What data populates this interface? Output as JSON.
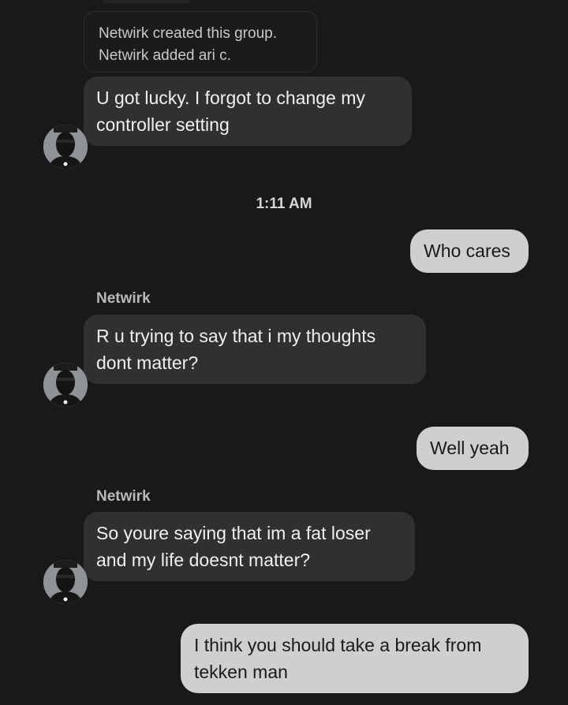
{
  "system": {
    "line1": "Netwirk created this group.",
    "line2": "Netwirk added ari c."
  },
  "timestamp": "1:11 AM",
  "messages": [
    {
      "direction": "incoming",
      "lines": [
        "U got lucky. I forgot to change my",
        "controller setting"
      ]
    },
    {
      "direction": "outgoing",
      "lines": [
        "Who cares"
      ]
    },
    {
      "direction": "incoming",
      "sender": "Netwirk",
      "lines": [
        "R u trying to say that i my thoughts",
        "dont matter?"
      ]
    },
    {
      "direction": "outgoing",
      "lines": [
        "Well yeah"
      ]
    },
    {
      "direction": "incoming",
      "sender": "Netwirk",
      "lines": [
        "So youre saying that im a fat loser",
        "and my life doesnt matter?"
      ]
    },
    {
      "direction": "outgoing",
      "lines": [
        "I think you should take a break from",
        "tekken man"
      ]
    }
  ],
  "icons": {
    "avatar": "user-avatar-icon"
  },
  "colors": {
    "background": "#19191b",
    "incoming_bubble": "#303033",
    "outgoing_bubble": "#cfcfcf"
  }
}
